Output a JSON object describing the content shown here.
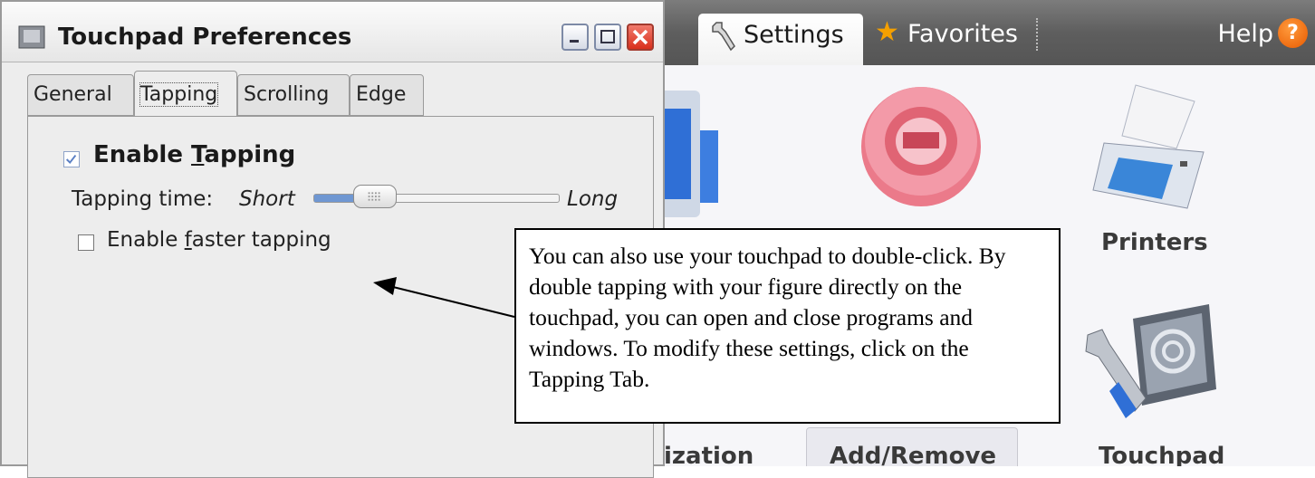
{
  "dialog": {
    "title": "Touchpad Preferences",
    "tabs": [
      "General",
      "Tapping",
      "Scrolling",
      "Edge"
    ],
    "active_tab": "Tapping",
    "enable_tapping": {
      "label_before": "Enable ",
      "mnemonic": "T",
      "label_after": "apping",
      "checked": true
    },
    "tapping_time": {
      "label": "Tapping time:",
      "min_label": "Short",
      "max_label": "Long",
      "value_fraction": 0.25
    },
    "faster_tapping": {
      "label_before": "Enable ",
      "mnemonic": "f",
      "label_after": "aster tapping",
      "checked": false
    }
  },
  "settings_app": {
    "tabs": {
      "settings": "Settings",
      "favorites": "Favorites"
    },
    "help_label": "Help",
    "help_icon_glyph": "?",
    "icons": [
      "system-icon",
      "eject-disc-icon",
      "printer-icon",
      "touchpad-wrench-icon"
    ],
    "items": {
      "printers": "Printers",
      "personalization": "ization",
      "add_remove": "Add/Remove",
      "touchpad": "Touchpad"
    }
  },
  "callout": {
    "text": "You can also use your touchpad to double-click.  By double tapping with your figure directly on the touchpad, you can open and close programs and windows.  To modify these settings, click on the Tapping Tab."
  },
  "colors": {
    "accent": "#6f97d2",
    "close_button": "#d9301c",
    "help_icon": "#e85a00",
    "favorites_star": "#f5a000"
  }
}
